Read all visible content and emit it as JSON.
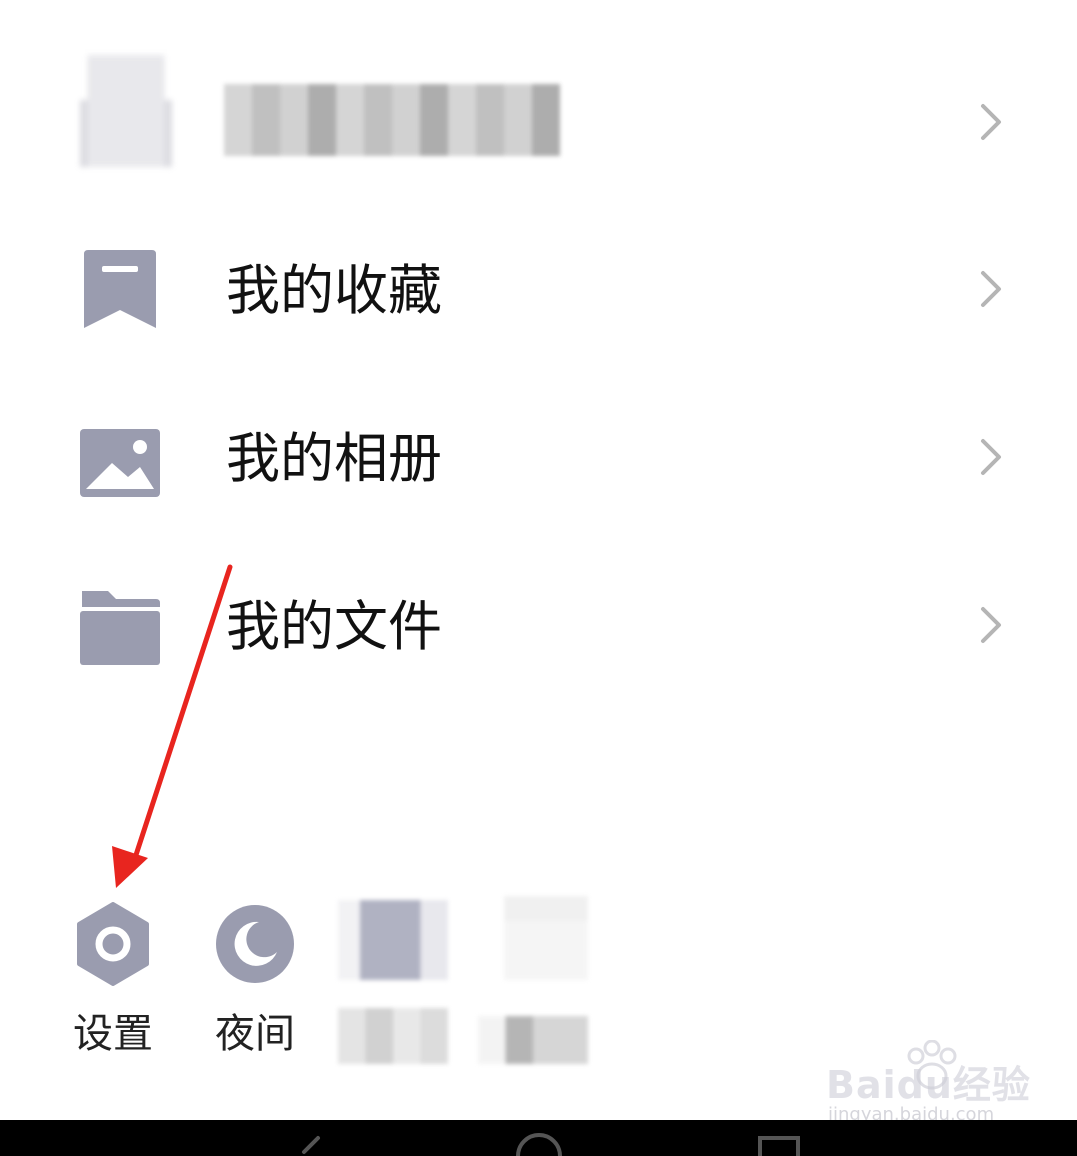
{
  "menu": {
    "items": [
      {
        "id": "redacted",
        "label": ""
      },
      {
        "id": "favorites",
        "label": "我的收藏",
        "icon": "bookmark-icon"
      },
      {
        "id": "album",
        "label": "我的相册",
        "icon": "image-icon"
      },
      {
        "id": "files",
        "label": "我的文件",
        "icon": "folder-icon"
      }
    ]
  },
  "toolbar": {
    "settings_label": "设置",
    "night_label": "夜间",
    "settings_icon": "hexagon-gear-icon",
    "night_icon": "moon-icon"
  },
  "watermark": {
    "brand": "Baidu经验",
    "url": "jingyan.baidu.com"
  },
  "colors": {
    "icon_gray": "#9a9caf",
    "chevron_gray": "#b5b5b5",
    "annotation_red": "#e8251f",
    "nav_bar": "#000000"
  }
}
